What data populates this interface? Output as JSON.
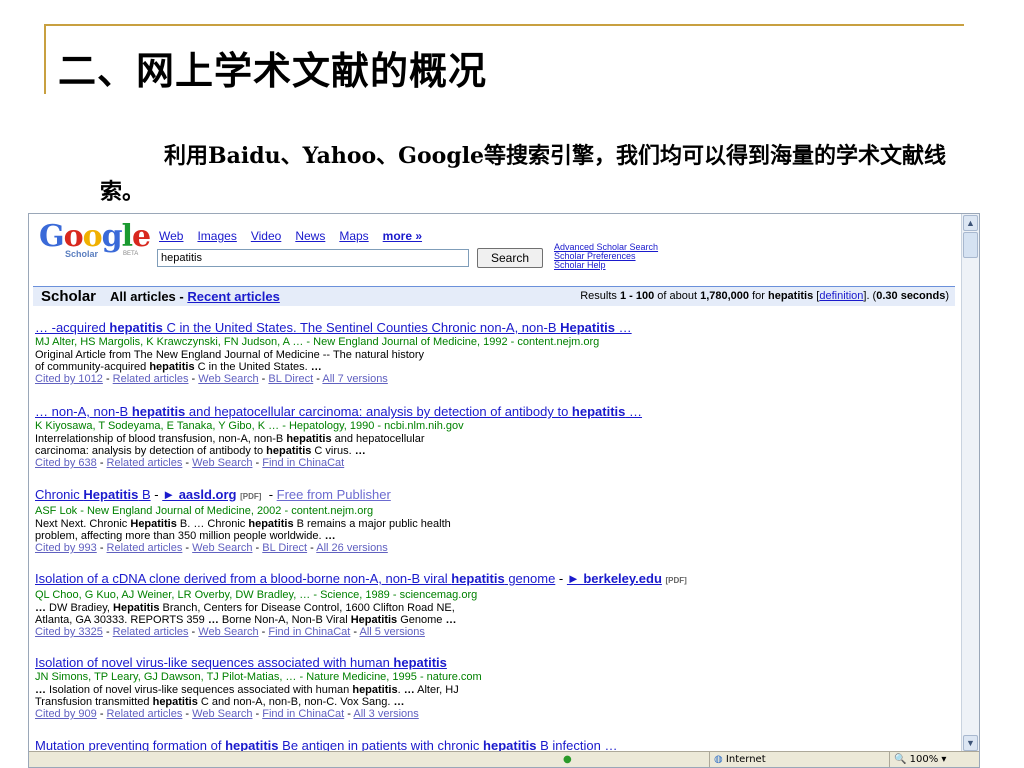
{
  "slide": {
    "title": "二、网上学术文献的概况",
    "paragraph": "利用Baidu、Yahoo、Google等搜索引擎，我们均可以得到海量的学术文献线索。"
  },
  "browser": {
    "logo": {
      "text": "Google",
      "subtext": "Scholar",
      "beta": "BETA"
    },
    "nav": [
      "Web",
      "Images",
      "Video",
      "News",
      "Maps",
      "more »"
    ],
    "search": {
      "value": "hepatitis",
      "button": "Search"
    },
    "adv_links": [
      "Advanced Scholar Search",
      "Scholar Preferences",
      "Scholar Help"
    ],
    "bar": {
      "brand": "Scholar",
      "all_articles": "All articles - ",
      "recent": "Recent articles",
      "stats_prefix": "Results ",
      "range": "1 - 100",
      "stats_mid": " of about ",
      "count": "1,780,000",
      "stats_for": " for ",
      "query": "hepatitis",
      "definition": "definition",
      "time": "0.30 seconds"
    },
    "results": [
      {
        "title_html": "… -acquired <b>hepatitis</b> C in the United States. The Sentinel Counties Chronic non-A, non-B <b>Hepatitis</b> …",
        "authors": "MJ Alter, HS Margolis, K Krawczynski, FN Judson, A … - New England Journal of Medicine, 1992 - content.nejm.org",
        "snippet": [
          "Original Article from The New England Journal of Medicine -- The natural history",
          "of community-acquired <b>hepatitis</b> C in the United States. <b>…</b>"
        ],
        "links": [
          "Cited by 1012",
          "Related articles",
          "Web Search",
          "BL Direct",
          "All 7 versions"
        ]
      },
      {
        "title_html": "… non-A, non-B <b>hepatitis</b> and hepatocellular carcinoma: analysis by detection of antibody to <b>hepatitis</b> …",
        "authors": "K Kiyosawa, T Sodeyama, E Tanaka, Y Gibo, K … - Hepatology, 1990 - ncbi.nlm.nih.gov",
        "snippet": [
          "Interrelationship of blood transfusion, non-A, non-B <b>hepatitis</b> and hepatocellular",
          "carcinoma: analysis by detection of antibody to <b>hepatitis</b> C virus. <b>…</b>"
        ],
        "links": [
          "Cited by 638",
          "Related articles",
          "Web Search",
          "Find in ChinaCat"
        ]
      },
      {
        "title_html": "Chronic <b>Hepatitis</b> B",
        "extra": {
          "arrow_link": "aasld.org",
          "pdf": "[PDF]",
          "free": "Free from Publisher"
        },
        "authors": "ASF Lok - New England Journal of Medicine, 2002 - content.nejm.org",
        "snippet": [
          "Next Next. Chronic <b>Hepatitis</b> B. … Chronic <b>hepatitis</b> B remains a major public health",
          "problem, affecting more than 350 million people worldwide. <b>…</b>"
        ],
        "links": [
          "Cited by 993",
          "Related articles",
          "Web Search",
          "BL Direct",
          "All 26 versions"
        ]
      },
      {
        "title_html": "Isolation of a cDNA clone derived from a blood-borne non-A, non-B viral <b>hepatitis</b> genome",
        "extra": {
          "arrow_link": "berkeley.edu",
          "pdf": "[PDF]"
        },
        "authors": "QL Choo, G Kuo, AJ Weiner, LR Overby, DW Bradley, … - Science, 1989 - sciencemag.org",
        "snippet": [
          "<b>…</b> DW Bradiey, <b>Hepatitis</b> Branch, Centers for Disease Control, 1600 Clifton Road NE,",
          "Atlanta, GA 30333. REPORTS 359 <b>…</b> Borne Non-A, Non-B Viral <b>Hepatitis</b> Genome <b>…</b>"
        ],
        "links": [
          "Cited by 3325",
          "Related articles",
          "Web Search",
          "Find in ChinaCat",
          "All 5 versions"
        ]
      },
      {
        "title_html": "Isolation of novel virus-like sequences associated with human <b>hepatitis</b>",
        "authors": "JN Simons, TP Leary, GJ Dawson, TJ Pilot-Matias, … - Nature Medicine, 1995 - nature.com",
        "snippet": [
          "<b>…</b> Isolation of novel virus-like sequences associated with human <b>hepatitis</b>. <b>…</b> Alter, HJ",
          "Transfusion transmitted <b>hepatitis</b> C and non-A, non-B, non-C. Vox Sang. <b>…</b>"
        ],
        "links": [
          "Cited by 909",
          "Related articles",
          "Web Search",
          "Find in ChinaCat",
          "All 3 versions"
        ]
      },
      {
        "title_html": "Mutation preventing formation of <b>hepatitis</b> Be antigen in patients with chronic <b>hepatitis</b> B infection …"
      }
    ],
    "status": {
      "zone": "Internet",
      "zoom": "100%"
    },
    "colors": {
      "link": "#1a1acc",
      "author_green": "#008000",
      "bar_bg": "#e5ecf9",
      "slide_accent": "#c8a040"
    }
  }
}
